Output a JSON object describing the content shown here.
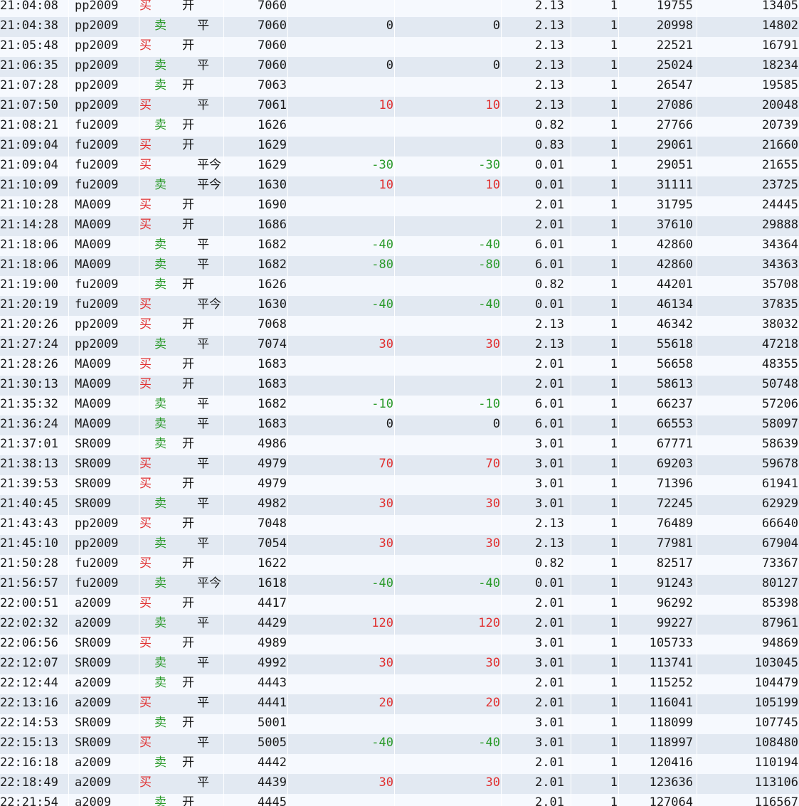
{
  "rows": [
    [
      "21:04:08",
      "pp2009",
      "买",
      "开",
      "7060",
      "",
      "",
      "2.13",
      "1",
      "19755",
      "13405"
    ],
    [
      "21:04:38",
      "pp2009",
      "卖",
      "平",
      "7060",
      "0",
      "0",
      "2.13",
      "1",
      "20998",
      "14802"
    ],
    [
      "21:05:48",
      "pp2009",
      "买",
      "开",
      "7060",
      "",
      "",
      "2.13",
      "1",
      "22521",
      "16791"
    ],
    [
      "21:06:35",
      "pp2009",
      "卖",
      "平",
      "7060",
      "0",
      "0",
      "2.13",
      "1",
      "25024",
      "18234"
    ],
    [
      "21:07:28",
      "pp2009",
      "卖",
      "开",
      "7063",
      "",
      "",
      "2.13",
      "1",
      "26547",
      "19585"
    ],
    [
      "21:07:50",
      "pp2009",
      "买",
      "平",
      "7061",
      "10",
      "10",
      "2.13",
      "1",
      "27086",
      "20048"
    ],
    [
      "21:08:21",
      "fu2009",
      "卖",
      "开",
      "1626",
      "",
      "",
      "0.82",
      "1",
      "27766",
      "20739"
    ],
    [
      "21:09:04",
      "fu2009",
      "买",
      "开",
      "1629",
      "",
      "",
      "0.83",
      "1",
      "29061",
      "21660"
    ],
    [
      "21:09:04",
      "fu2009",
      "买",
      "平今",
      "1629",
      "-30",
      "-30",
      "0.01",
      "1",
      "29051",
      "21655"
    ],
    [
      "21:10:09",
      "fu2009",
      "卖",
      "平今",
      "1630",
      "10",
      "10",
      "0.01",
      "1",
      "31111",
      "23725"
    ],
    [
      "21:10:28",
      "MA009",
      "买",
      "开",
      "1690",
      "",
      "",
      "2.01",
      "1",
      "31795",
      "24445"
    ],
    [
      "21:14:28",
      "MA009",
      "买",
      "开",
      "1686",
      "",
      "",
      "2.01",
      "1",
      "37610",
      "29888"
    ],
    [
      "21:18:06",
      "MA009",
      "卖",
      "平",
      "1682",
      "-40",
      "-40",
      "6.01",
      "1",
      "42860",
      "34364"
    ],
    [
      "21:18:06",
      "MA009",
      "卖",
      "平",
      "1682",
      "-80",
      "-80",
      "6.01",
      "1",
      "42860",
      "34363"
    ],
    [
      "21:19:00",
      "fu2009",
      "卖",
      "开",
      "1626",
      "",
      "",
      "0.82",
      "1",
      "44201",
      "35708"
    ],
    [
      "21:20:19",
      "fu2009",
      "买",
      "平今",
      "1630",
      "-40",
      "-40",
      "0.01",
      "1",
      "46134",
      "37835"
    ],
    [
      "21:20:26",
      "pp2009",
      "买",
      "开",
      "7068",
      "",
      "",
      "2.13",
      "1",
      "46342",
      "38032"
    ],
    [
      "21:27:24",
      "pp2009",
      "卖",
      "平",
      "7074",
      "30",
      "30",
      "2.13",
      "1",
      "55618",
      "47218"
    ],
    [
      "21:28:26",
      "MA009",
      "买",
      "开",
      "1683",
      "",
      "",
      "2.01",
      "1",
      "56658",
      "48355"
    ],
    [
      "21:30:13",
      "MA009",
      "买",
      "开",
      "1683",
      "",
      "",
      "2.01",
      "1",
      "58613",
      "50748"
    ],
    [
      "21:35:32",
      "MA009",
      "卖",
      "平",
      "1682",
      "-10",
      "-10",
      "6.01",
      "1",
      "66237",
      "57206"
    ],
    [
      "21:36:24",
      "MA009",
      "卖",
      "平",
      "1683",
      "0",
      "0",
      "6.01",
      "1",
      "66553",
      "58097"
    ],
    [
      "21:37:01",
      "SR009",
      "卖",
      "开",
      "4986",
      "",
      "",
      "3.01",
      "1",
      "67771",
      "58639"
    ],
    [
      "21:38:13",
      "SR009",
      "买",
      "平",
      "4979",
      "70",
      "70",
      "3.01",
      "1",
      "69203",
      "59678"
    ],
    [
      "21:39:53",
      "SR009",
      "买",
      "开",
      "4979",
      "",
      "",
      "3.01",
      "1",
      "71396",
      "61941"
    ],
    [
      "21:40:45",
      "SR009",
      "卖",
      "平",
      "4982",
      "30",
      "30",
      "3.01",
      "1",
      "72245",
      "62929"
    ],
    [
      "21:43:43",
      "pp2009",
      "买",
      "开",
      "7048",
      "",
      "",
      "2.13",
      "1",
      "76489",
      "66640"
    ],
    [
      "21:45:10",
      "pp2009",
      "卖",
      "平",
      "7054",
      "30",
      "30",
      "2.13",
      "1",
      "77981",
      "67904"
    ],
    [
      "21:50:28",
      "fu2009",
      "买",
      "开",
      "1622",
      "",
      "",
      "0.82",
      "1",
      "82517",
      "73367"
    ],
    [
      "21:56:57",
      "fu2009",
      "卖",
      "平今",
      "1618",
      "-40",
      "-40",
      "0.01",
      "1",
      "91243",
      "80127"
    ],
    [
      "22:00:51",
      "a2009",
      "买",
      "开",
      "4417",
      "",
      "",
      "2.01",
      "1",
      "96292",
      "85398"
    ],
    [
      "22:02:32",
      "a2009",
      "卖",
      "平",
      "4429",
      "120",
      "120",
      "2.01",
      "1",
      "99227",
      "87961"
    ],
    [
      "22:06:56",
      "SR009",
      "买",
      "开",
      "4989",
      "",
      "",
      "3.01",
      "1",
      "105733",
      "94869"
    ],
    [
      "22:12:07",
      "SR009",
      "卖",
      "平",
      "4992",
      "30",
      "30",
      "3.01",
      "1",
      "113741",
      "103045"
    ],
    [
      "22:12:44",
      "a2009",
      "卖",
      "开",
      "4443",
      "",
      "",
      "2.01",
      "1",
      "115252",
      "104479"
    ],
    [
      "22:13:16",
      "a2009",
      "买",
      "平",
      "4441",
      "20",
      "20",
      "2.01",
      "1",
      "116041",
      "105199"
    ],
    [
      "22:14:53",
      "SR009",
      "卖",
      "开",
      "5001",
      "",
      "",
      "3.01",
      "1",
      "118099",
      "107745"
    ],
    [
      "22:15:13",
      "SR009",
      "买",
      "平",
      "5005",
      "-40",
      "-40",
      "3.01",
      "1",
      "118997",
      "108480"
    ],
    [
      "22:16:18",
      "a2009",
      "卖",
      "开",
      "4442",
      "",
      "",
      "2.01",
      "1",
      "120416",
      "110194"
    ],
    [
      "22:18:49",
      "a2009",
      "买",
      "平",
      "4439",
      "30",
      "30",
      "2.01",
      "1",
      "123636",
      "113106"
    ],
    [
      "22:21:54",
      "a2009",
      "卖",
      "开",
      "4445",
      "",
      "",
      "2.01",
      "1",
      "127064",
      "116567"
    ]
  ],
  "colors": {
    "buy": "#e03030",
    "sell": "#2a9a2a",
    "row_odd": "#f6f9fe",
    "row_even": "#e2e9f2"
  }
}
